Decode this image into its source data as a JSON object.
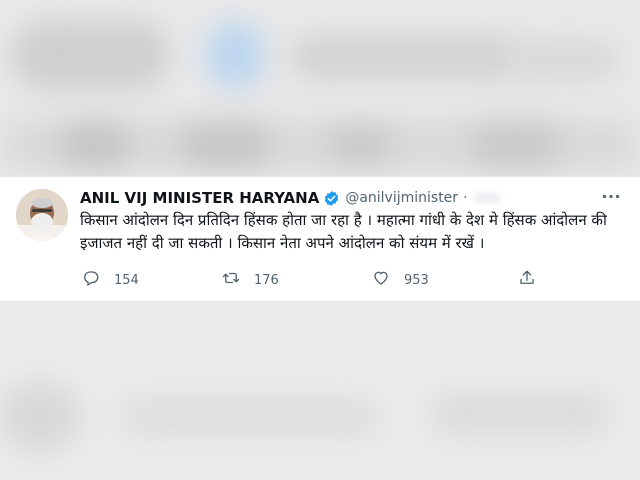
{
  "tweet": {
    "display_name": "ANIL VIJ MINISTER HARYANA",
    "handle": "@anilvijminister",
    "separator": "·",
    "text": "किसान आंदोलन दिन प्रतिदिन हिंसक होता जा रहा है । महात्मा गांधी के देश मे हिंसक आंदोलन की इजाजत नहीं दी जा सकती । किसान नेता अपने आंदोलन को संयम में रखें ।",
    "verified": true,
    "actions": {
      "reply_count": "154",
      "retweet_count": "176",
      "like_count": "953"
    },
    "icons": {
      "verified": "verified-badge-icon",
      "more": "more-options-icon",
      "reply": "reply-icon",
      "retweet": "retweet-icon",
      "like": "like-heart-icon",
      "share": "share-icon"
    },
    "colors": {
      "verified_blue": "#1d9bf0",
      "text": "#0f1419",
      "secondary": "#536471"
    }
  }
}
